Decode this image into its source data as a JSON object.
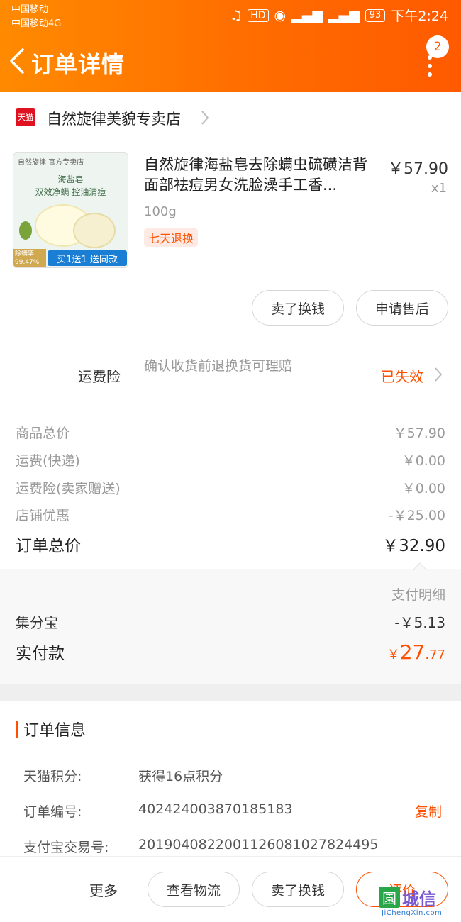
{
  "status_bar": {
    "carrier1": "中国移动",
    "carrier2": "中国移动4G",
    "hd": "HD",
    "battery": "93",
    "time": "下午2:24"
  },
  "header": {
    "title": "订单详情",
    "notification_count": "2"
  },
  "shop": {
    "logo_text": "天猫",
    "name": "自然旋律美貌专卖店"
  },
  "product": {
    "title": "自然旋律海盐皂去除螨虫硫磺洁背面部祛痘男女洗脸澡手工香...",
    "price": "￥57.90",
    "quantity": "x1",
    "spec": "100g",
    "return_tag": "七天退换",
    "image": {
      "brand": "自然旋律 官方专卖店",
      "line1": "海盐皂",
      "line2": "双效净螨 控油清痘",
      "tag": "除螨率 99.47%",
      "promo": "买1送1 送同款"
    }
  },
  "item_actions": {
    "sell": "卖了换钱",
    "after_sale": "申请售后"
  },
  "insurance": {
    "label": "运费险",
    "desc": "确认收货前退换货可理赔",
    "status": "已失效"
  },
  "prices": [
    {
      "label": "商品总价",
      "value": "￥57.90"
    },
    {
      "label": "运费(快递)",
      "value": "￥0.00"
    },
    {
      "label": "运费险(卖家赠送)",
      "value": "￥0.00"
    },
    {
      "label": "店铺优惠",
      "value": "-￥25.00"
    }
  ],
  "total": {
    "label": "订单总价",
    "value": "￥32.90"
  },
  "payment": {
    "detail_label": "支付明细",
    "jfb_label": "集分宝",
    "jfb_value": "-￥5.13",
    "paid_label": "实付款",
    "paid_currency": "￥",
    "paid_int": "27",
    "paid_dec": ".77"
  },
  "order_info": {
    "title": "订单信息",
    "points_label": "天猫积分:",
    "points_value": "获得16点积分",
    "order_no_label": "订单编号:",
    "order_no_value": "402424003870185183",
    "copy": "复制",
    "alipay_label": "支付宝交易号:",
    "alipay_value": "2019040822001126081027824495"
  },
  "bottom": {
    "more": "更多",
    "logistics": "查看物流",
    "sell": "卖了换钱",
    "evaluate": "评价"
  },
  "watermark": {
    "text": "城信",
    "url": "JiChengXin.com"
  },
  "colors": {
    "accent": "#ff5000",
    "header_gradient_start": "#ff8a00",
    "header_gradient_end": "#ff5a00"
  }
}
